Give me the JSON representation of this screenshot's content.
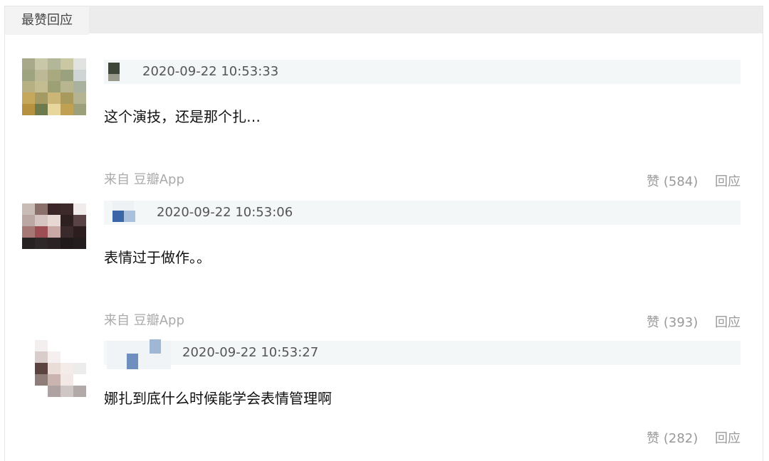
{
  "section": {
    "tab_label": "最赞回应"
  },
  "comments": [
    {
      "timestamp": "2020-09-22 10:53:33",
      "text": "这个演技，还是那个扎…",
      "source": "来自 豆瓣App",
      "like_label": "赞 (584)",
      "reply_label": "回应"
    },
    {
      "timestamp": "2020-09-22 10:53:06",
      "text": "表情过于做作。。",
      "source": "来自 豆瓣App",
      "like_label": "赞 (393)",
      "reply_label": "回应"
    },
    {
      "timestamp": "2020-09-22 10:53:27",
      "text": "娜扎到底什么时候能学会表情管理啊",
      "like_label": "赞 (282)",
      "reply_label": "回应"
    }
  ]
}
